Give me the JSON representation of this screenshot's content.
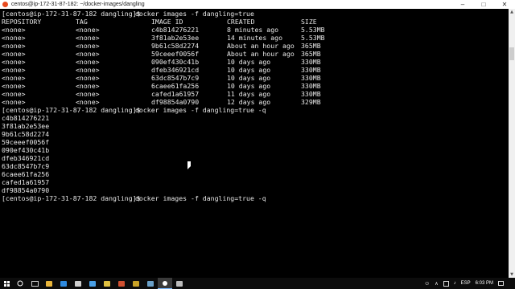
{
  "window": {
    "title": "centos@ip-172-31-87-182: ~/docker-images/dangling"
  },
  "terminal": {
    "prompt": "[centos@ip-172-31-87-182 dangling]$ ",
    "commands": [
      "docker images -f dangling=true",
      "docker images -f dangling=true -q",
      "docker images -f dangling=true -q"
    ],
    "table": {
      "headers": [
        "REPOSITORY",
        "TAG",
        "IMAGE ID",
        "CREATED",
        "SIZE"
      ],
      "rows": [
        [
          "<none>",
          "<none>",
          "c4b814276221",
          "8 minutes ago",
          "5.53MB"
        ],
        [
          "<none>",
          "<none>",
          "3f81ab2e53ee",
          "14 minutes ago",
          "5.53MB"
        ],
        [
          "<none>",
          "<none>",
          "9b61c58d2274",
          "About an hour ago",
          "365MB"
        ],
        [
          "<none>",
          "<none>",
          "59ceeef0056f",
          "About an hour ago",
          "365MB"
        ],
        [
          "<none>",
          "<none>",
          "090ef430c41b",
          "10 days ago",
          "330MB"
        ],
        [
          "<none>",
          "<none>",
          "dfeb346921cd",
          "10 days ago",
          "330MB"
        ],
        [
          "<none>",
          "<none>",
          "63dc8547b7c9",
          "10 days ago",
          "330MB"
        ],
        [
          "<none>",
          "<none>",
          "6caee61fa256",
          "10 days ago",
          "330MB"
        ],
        [
          "<none>",
          "<none>",
          "cafed1a61957",
          "11 days ago",
          "330MB"
        ],
        [
          "<none>",
          "<none>",
          "df98854a0790",
          "12 days ago",
          "329MB"
        ]
      ]
    },
    "ids": [
      "c4b814276221",
      "3f81ab2e53ee",
      "9b61c58d2274",
      "59ceeef0056f",
      "090ef430c41b",
      "dfeb346921cd",
      "63dc8547b7c9",
      "6caee61fa256",
      "cafed1a61957",
      "df98854a0790"
    ]
  },
  "taskbar": {
    "apps": [
      {
        "icon": "file-explorer-icon",
        "color": "#e8b53a"
      },
      {
        "icon": "edge-browser-icon",
        "color": "#2f8be0"
      },
      {
        "icon": "store-icon",
        "color": "#cfcfcf"
      },
      {
        "icon": "mail-icon",
        "color": "#4aa0e6"
      },
      {
        "icon": "app-icon",
        "color": "#e0c040"
      },
      {
        "icon": "app-icon",
        "color": "#d05030"
      },
      {
        "icon": "app-icon",
        "color": "#c9a227"
      },
      {
        "icon": "app-icon",
        "color": "#6aa0c8"
      },
      {
        "icon": "terminal-icon",
        "color": "#ffffff"
      },
      {
        "icon": "app-icon",
        "color": "#bbbbbb"
      }
    ],
    "language": "ESP",
    "time": "6:03 PM"
  },
  "colors": {
    "terminal_bg": "#000000",
    "terminal_fg": "#e8e8e8",
    "titlebar_bg": "#ffffff",
    "taskbar_bg": "#0c0c0c",
    "accent": "#e84a1e"
  }
}
